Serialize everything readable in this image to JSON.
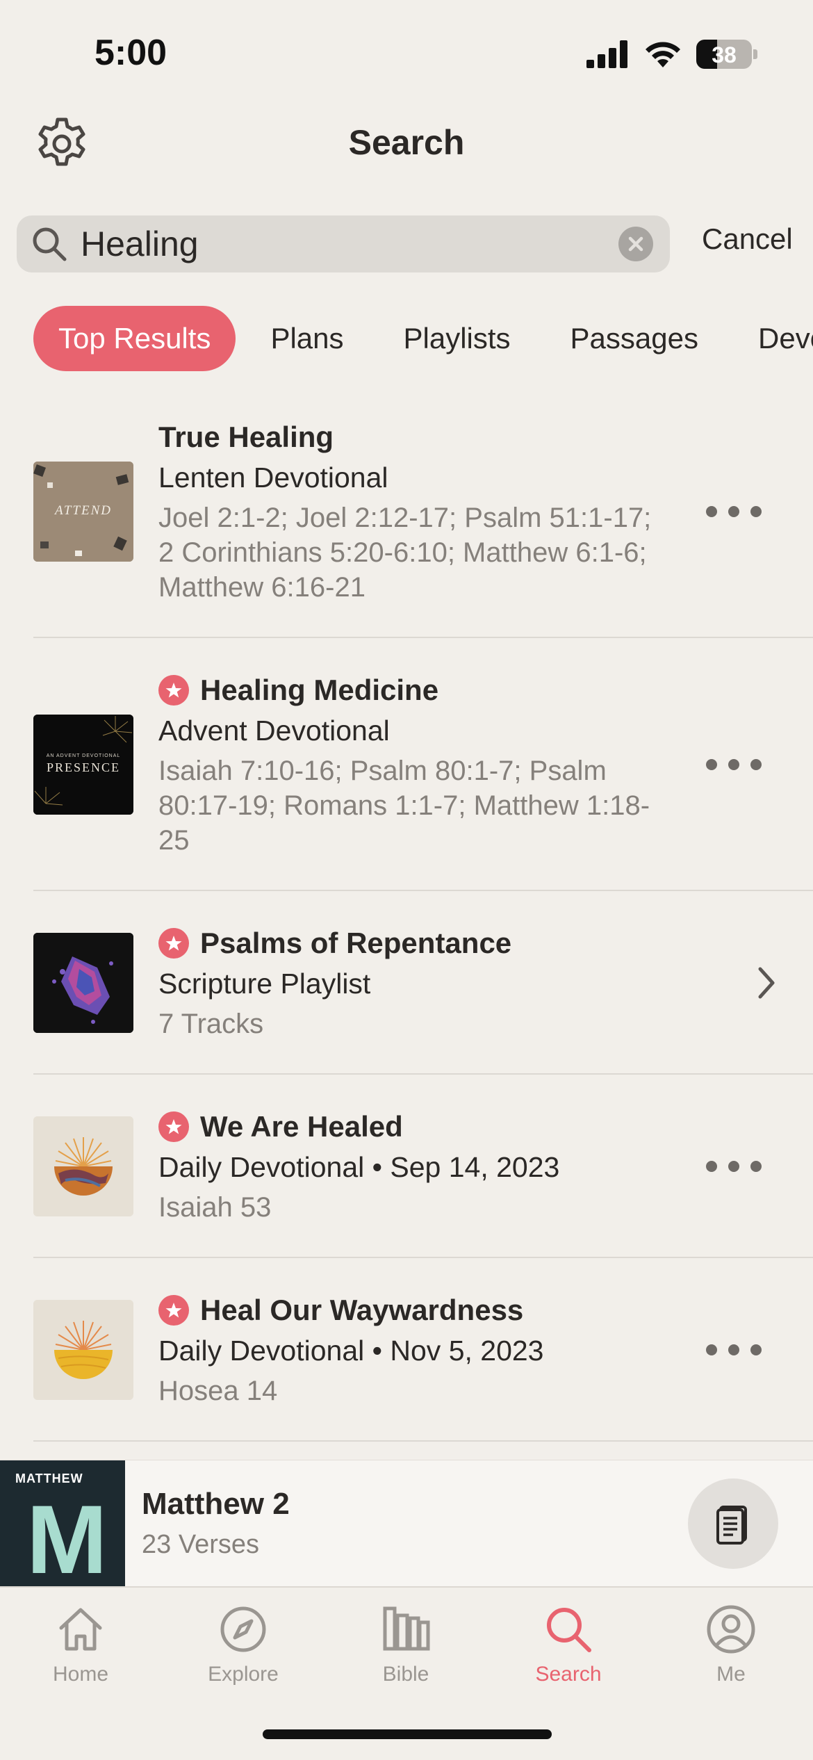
{
  "status_bar": {
    "time": "5:00",
    "battery": "38",
    "battery_level": 0.38
  },
  "header": {
    "title": "Search",
    "settings_icon": "gear-icon"
  },
  "search": {
    "query": "Healing",
    "cancel_label": "Cancel"
  },
  "tabs": [
    {
      "label": "Top Results",
      "active": true
    },
    {
      "label": "Plans",
      "active": false
    },
    {
      "label": "Playlists",
      "active": false
    },
    {
      "label": "Passages",
      "active": false
    },
    {
      "label": "Devotionals",
      "active": false
    }
  ],
  "results": [
    {
      "title": "True Healing",
      "subtitle": "Lenten Devotional",
      "meta": "Joel 2:1-2; Joel 2:12-17; Psalm 51:1-17; 2 Corinthians 5:20-6:10; Matthew 6:1-6; Matthew 6:16-21",
      "thumb_text": "ATTEND",
      "starred": false,
      "action": "more"
    },
    {
      "title": "Healing Medicine",
      "subtitle": "Advent Devotional",
      "meta": "Isaiah 7:10-16; Psalm 80:1-7; Psalm 80:17-19; Romans 1:1-7; Matthew 1:18-25",
      "thumb_text": "PRESENCE",
      "thumb_small_text": "AN ADVENT DEVOTIONAL",
      "starred": true,
      "action": "more"
    },
    {
      "title": "Psalms of Repentance",
      "subtitle": "Scripture Playlist",
      "meta": "7 Tracks",
      "starred": true,
      "action": "chevron"
    },
    {
      "title": "We Are Healed",
      "subtitle": "Daily Devotional • Sep 14, 2023",
      "meta": "Isaiah 53",
      "starred": true,
      "action": "more"
    },
    {
      "title": "Heal Our Waywardness",
      "subtitle": "Daily Devotional • Nov 5, 2023",
      "meta": "Hosea 14",
      "starred": true,
      "action": "more"
    }
  ],
  "mini_player": {
    "art_label": "MATTHEW",
    "art_letter": "M",
    "title": "Matthew 2",
    "subtitle": "23 Verses"
  },
  "tab_bar": [
    {
      "label": "Home",
      "icon": "home-icon",
      "active": false
    },
    {
      "label": "Explore",
      "icon": "compass-icon",
      "active": false
    },
    {
      "label": "Bible",
      "icon": "books-icon",
      "active": false
    },
    {
      "label": "Search",
      "icon": "search-icon",
      "active": true
    },
    {
      "label": "Me",
      "icon": "person-icon",
      "active": false
    }
  ],
  "colors": {
    "accent": "#e8636f",
    "background": "#f2efea",
    "text": "#2b2826",
    "muted": "#85807b"
  }
}
